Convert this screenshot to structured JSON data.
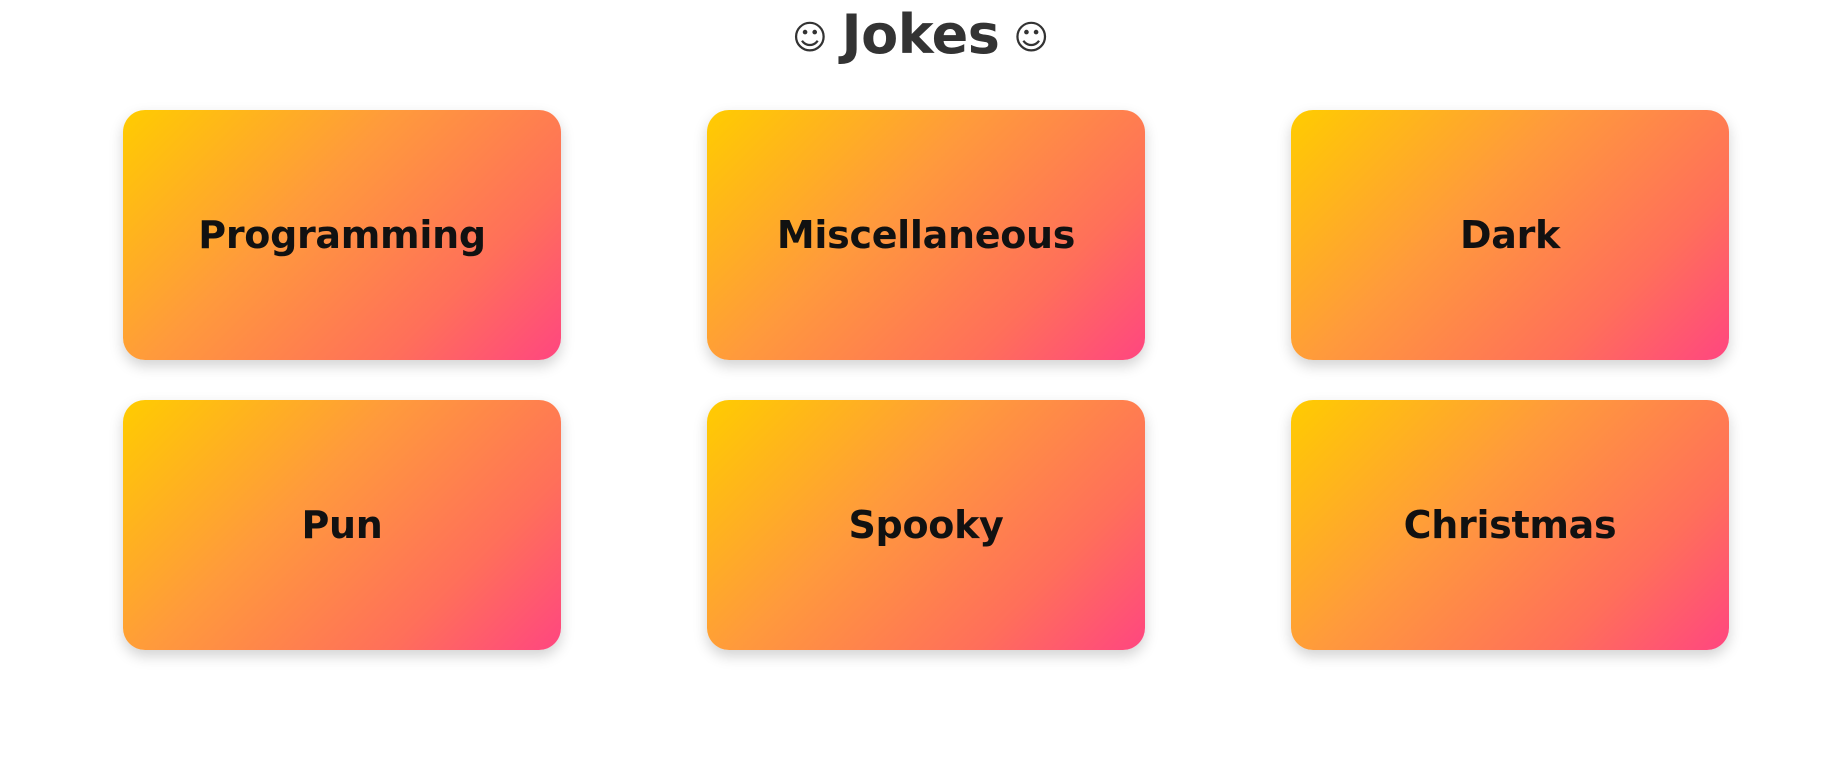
{
  "header": {
    "title": "Jokes",
    "left_icon": "☺",
    "right_icon": "☺",
    "icon_name": "smiley-icon"
  },
  "categories": [
    {
      "label": "Programming"
    },
    {
      "label": "Miscellaneous"
    },
    {
      "label": "Dark"
    },
    {
      "label": "Pun"
    },
    {
      "label": "Spooky"
    },
    {
      "label": "Christmas"
    }
  ],
  "colors": {
    "gradient_start": "#ffcc00",
    "gradient_end": "#ff4680",
    "text": "#111111",
    "title": "#333333",
    "background": "#ffffff"
  }
}
